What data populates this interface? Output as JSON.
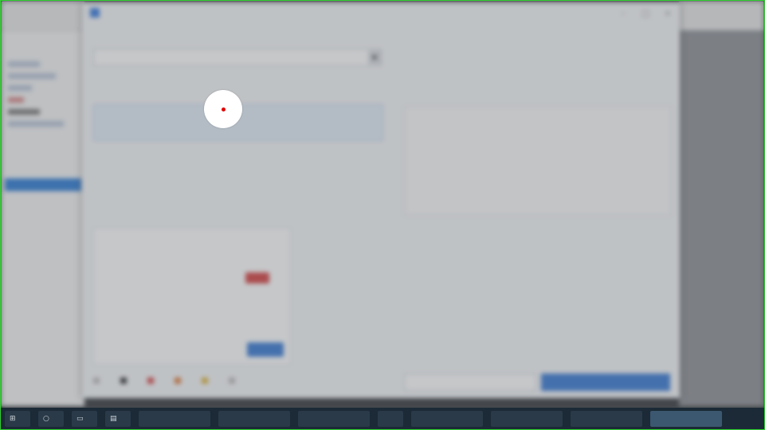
{
  "dialog": {
    "title": "",
    "section_top_label": "",
    "combo_value": "",
    "section_list_label": "",
    "list_item_title": "",
    "list_item_sub": "",
    "section_detail_label": "",
    "detail_title": "",
    "detail_sub": "",
    "panel": {
      "title": "",
      "row1": "",
      "row2": "",
      "row3": "",
      "row4": "",
      "tag": "",
      "button": ""
    },
    "section_preview_label": "",
    "empty_message": "",
    "legend": [
      "",
      "",
      "",
      "",
      "",
      ""
    ],
    "secondary_button": "",
    "primary_button": ""
  },
  "colors": {
    "accent": "#3a7bd5",
    "danger": "#d84343",
    "section_label": "#2b4c7e",
    "legend_swatches": [
      "#bbbbbb",
      "#333333",
      "#d84343",
      "#e07a3a",
      "#e0b43a",
      "#bbbbbb"
    ]
  },
  "taskbar": {
    "items": [
      "start-icon",
      "search-icon",
      "task-view-icon",
      "folder-icon",
      "",
      "",
      "",
      "",
      "",
      "",
      "",
      "",
      ""
    ],
    "clock": ""
  }
}
